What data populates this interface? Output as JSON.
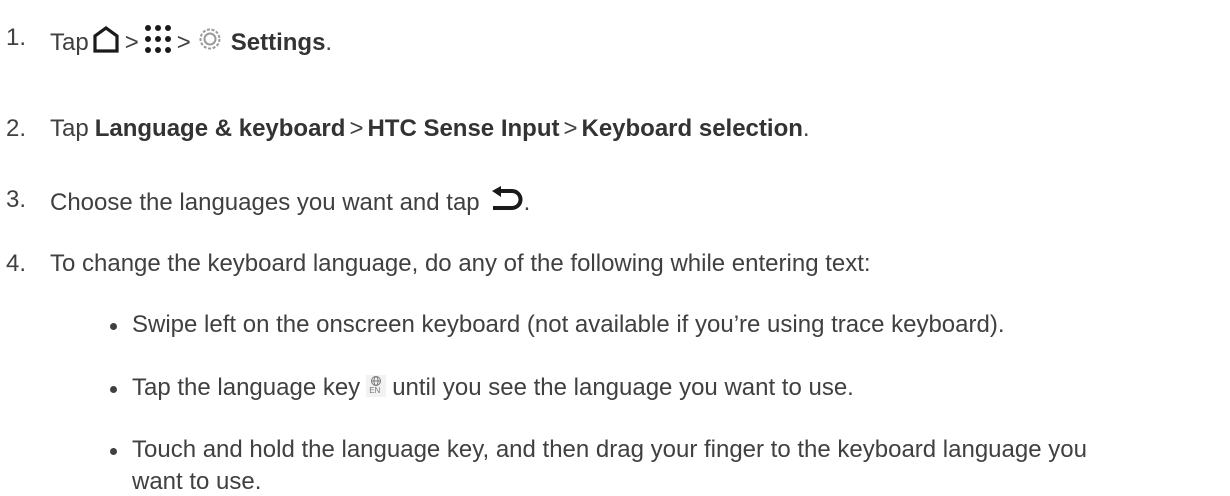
{
  "steps": [
    {
      "number": "1.",
      "tap": "Tap",
      "gt1": ">",
      "gt2": ">",
      "settings": "Settings",
      "end": ".",
      "icons": [
        "home-icon",
        "apps-grid-icon",
        "settings-gear-icon"
      ]
    },
    {
      "number": "2.",
      "tap": "Tap",
      "item1": "Language & keyboard",
      "gt1": ">",
      "item2": "HTC Sense Input",
      "gt2": ">",
      "item3": "Keyboard selection",
      "end": "."
    },
    {
      "number": "3.",
      "text": "Choose the languages you want and tap",
      "end": ".",
      "icon": "back-arrow-icon"
    },
    {
      "number": "4.",
      "text": "To change the keyboard language, do any of the following while entering text:"
    }
  ],
  "bullets": [
    {
      "text": "Swipe left on the onscreen keyboard (not available if you’re using trace keyboard)."
    },
    {
      "pre": "Tap the language key",
      "post": "until you see the language you want to use.",
      "icon": "language-key-icon",
      "icon_label": "EN"
    },
    {
      "line1": "Touch and hold the language key, and then drag your finger to the keyboard language you",
      "line2": "want to use."
    }
  ],
  "colors": {
    "text": "#404040",
    "icon": "#1a1a1a",
    "gear": "#9a9a9a"
  }
}
